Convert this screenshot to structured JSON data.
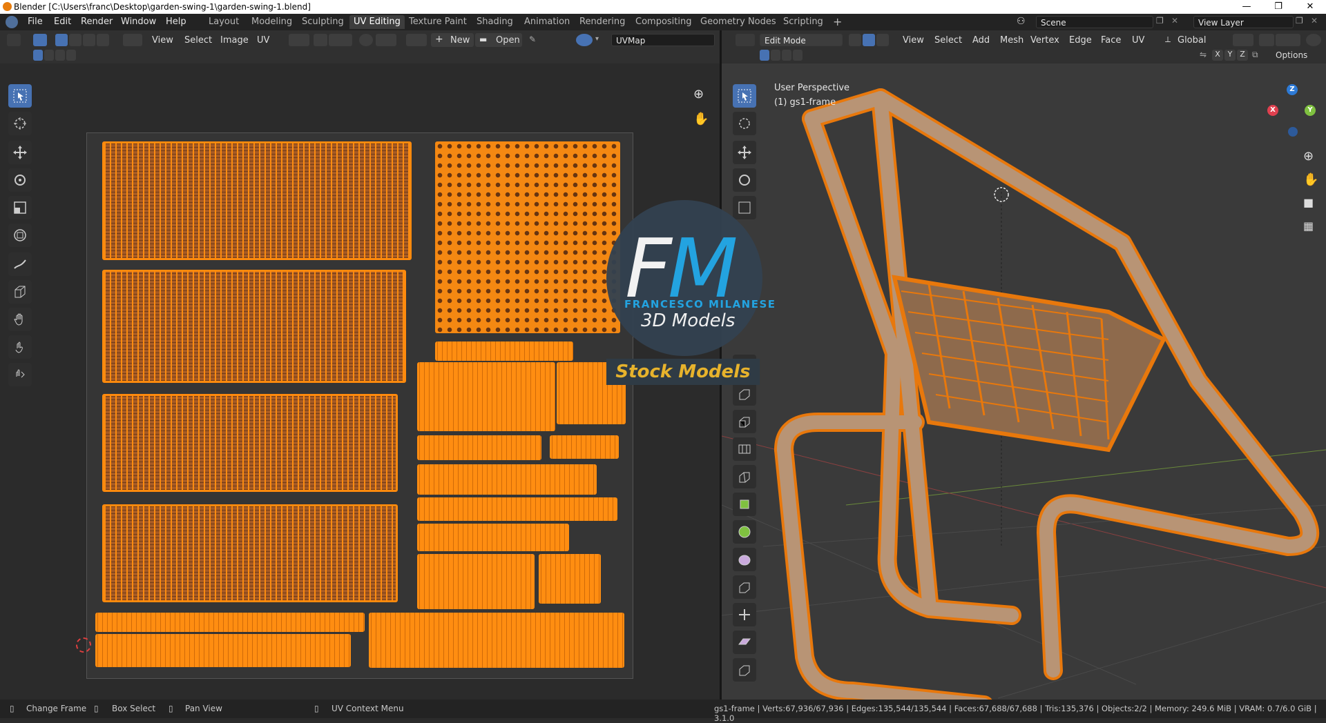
{
  "window": {
    "title": "Blender [C:\\Users\\franc\\Desktop\\garden-swing-1\\garden-swing-1.blend]",
    "controls": [
      "—",
      "❐",
      "✕"
    ]
  },
  "menu": [
    "File",
    "Edit",
    "Render",
    "Window",
    "Help"
  ],
  "workspaces": [
    "Layout",
    "Modeling",
    "Sculpting",
    "UV Editing",
    "Texture Paint",
    "Shading",
    "Animation",
    "Rendering",
    "Compositing",
    "Geometry Nodes",
    "Scripting"
  ],
  "active_workspace": "UV Editing",
  "add_workspace": "+",
  "scene": {
    "label": "Scene",
    "view_layer": "View Layer"
  },
  "uv_header": {
    "menus": [
      "View",
      "Select",
      "Image",
      "UV"
    ],
    "new_label": "New",
    "open_label": "Open",
    "uvmap": "UVMap"
  },
  "view3d_header": {
    "mode": "Edit Mode",
    "menus": [
      "View",
      "Select",
      "Add",
      "Mesh",
      "Vertex",
      "Edge",
      "Face",
      "UV"
    ],
    "orientation": "Global",
    "axes": [
      "X",
      "Y",
      "Z"
    ],
    "options": "Options"
  },
  "viewport": {
    "perspective": "User Perspective",
    "object": "(1) gs1-frame",
    "gizmo": {
      "x": "X",
      "y": "Y",
      "z": "Z"
    }
  },
  "watermark": {
    "letters_f": "F",
    "letters_m": "M",
    "name": "FRANCESCO MILANESE",
    "subtitle": "3D Models",
    "stock": "Stock Models"
  },
  "status": {
    "change_frame": "Change Frame",
    "box_select": "Box Select",
    "pan_view": "Pan View",
    "context_menu": "UV Context Menu",
    "stats": "gs1-frame | Verts:67,936/67,936 | Edges:135,544/135,544 | Faces:67,688/67,688 | Tris:135,376 | Objects:2/2 | Memory: 249.6 MiB | VRAM: 0.7/6.0 GiB | 3.1.0"
  },
  "colors": {
    "accent": "#4772b3",
    "uv_orange": "#ff8d11",
    "mesh_orange": "#e8780c",
    "fm_blue": "#23a3e0",
    "stock_yellow": "#e7b32c"
  }
}
